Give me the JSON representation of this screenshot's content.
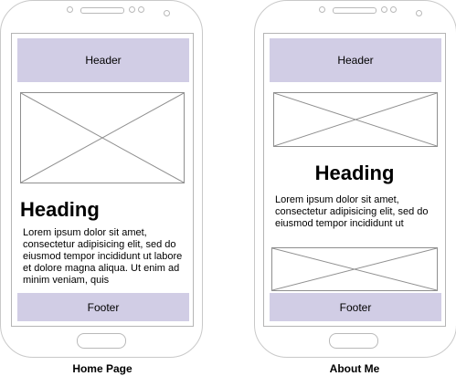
{
  "colors": {
    "bar_fill": "#d1cde5",
    "device_outline": "#c9c9c9",
    "placeholder_line": "#8f8f8f"
  },
  "icons": {
    "image_placeholder": "crossed-box-icon"
  },
  "home_page": {
    "header": "Header",
    "heading": "Heading",
    "body_text": "Lorem ipsum dolor sit amet, consectetur adipisicing elit, sed do eiusmod tempor incididunt ut labore et dolore magna aliqua. Ut enim ad minim veniam, quis",
    "footer": "Footer",
    "caption": "Home Page"
  },
  "about_page": {
    "header": "Header",
    "heading": "Heading",
    "body_text": "Lorem ipsum dolor sit amet, consectetur adipisicing elit, sed do eiusmod tempor incididunt ut",
    "footer": "Footer",
    "caption": "About Me"
  }
}
